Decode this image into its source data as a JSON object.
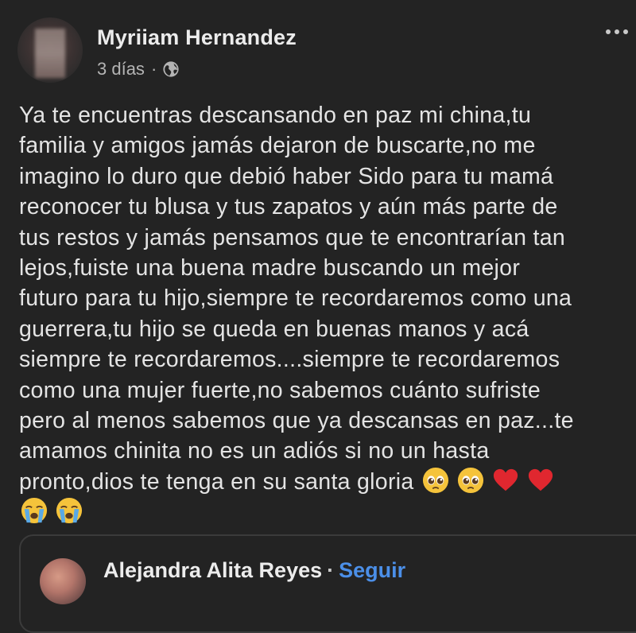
{
  "post": {
    "author": "Myriiam Hernandez",
    "time": "3 días",
    "separator": "·",
    "privacy_icon": "globe-icon",
    "more_icon": "more-options-icon",
    "lines": [
      "Ya te encuentras descansando en paz mi china,tu",
      "familia y amigos jamás dejaron de buscarte,no me",
      "imagino lo duro que debió haber Sido para tu mamá",
      "reconocer tu blusa y tus zapatos y aún más parte de",
      "tus restos y jamás pensamos que te encontrarían tan",
      "lejos,fuiste una buena madre buscando un mejor",
      "futuro para tu hijo,siempre te recordaremos como una",
      "guerrera,tu hijo se queda en buenas manos y acá",
      "siempre te recordaremos....siempre te recordaremos",
      "como una mujer fuerte,no sabemos cuánto sufriste",
      "pero al menos sabemos que ya descansas en paz...te",
      "amamos chinita no es un adiós si no un hasta",
      "pronto,dios te tenga en su santa gloria"
    ],
    "emojis_line13": [
      "pleading-face-emoji",
      "pleading-face-emoji",
      "red-heart-emoji",
      "red-heart-emoji"
    ],
    "emojis_line14": [
      "loudly-crying-face-emoji",
      "loudly-crying-face-emoji"
    ]
  },
  "shared_post": {
    "author": "Alejandra Alita Reyes",
    "separator": "·",
    "follow_label": "Seguir"
  },
  "colors": {
    "background": "#232323",
    "text": "#e4e4e4",
    "meta_text": "#b4b4b4",
    "link_blue": "#4b8fe8"
  }
}
